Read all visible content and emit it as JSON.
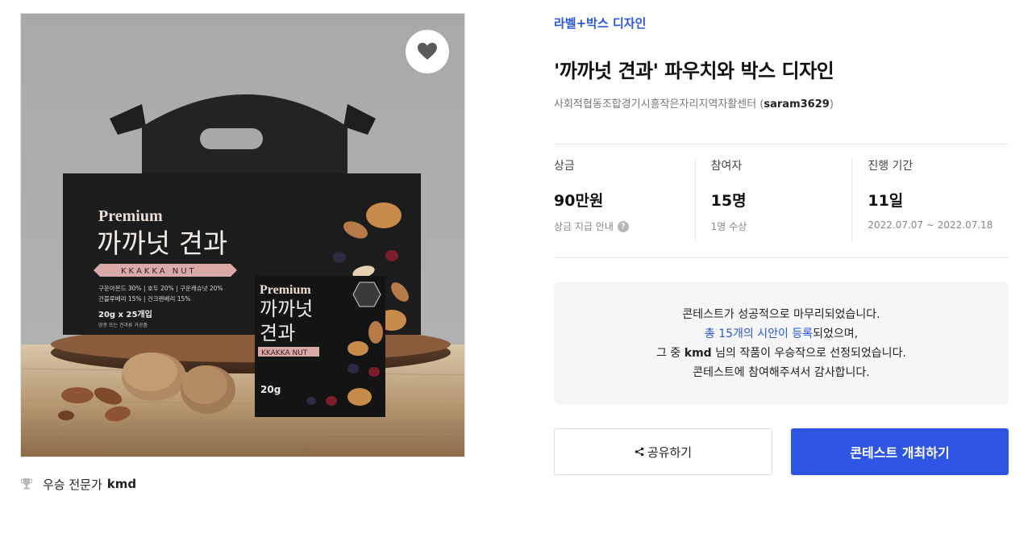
{
  "image": {
    "box_brand": "Premium",
    "box_name": "까까넛 견과",
    "box_subtitle": "KKAKKA NUT",
    "box_ingredients_1": "구운아몬드 30% | 호두 20% | 구운캐슈넛 20%",
    "box_ingredients_2": "건블루베리 15% | 건크랜베리 15%",
    "box_qty": "20g x 25개입",
    "box_note": "땅콩 또는 견과류 가공품",
    "pouch_brand": "Premium",
    "pouch_name_1": "까까넛",
    "pouch_name_2": "견과",
    "pouch_subtitle": "KKAKKA NUT",
    "pouch_weight": "20g"
  },
  "winner": {
    "label": "우승 전문가",
    "name": "kmd"
  },
  "contest": {
    "category": "라벨+박스 디자인",
    "title": "'까까넛 견과' 파우치와 박스 디자인",
    "organizer": "사회적협동조합경기시흥작은자리지역자활센터",
    "handle": "saram3629"
  },
  "stats": [
    {
      "label": "상금",
      "value": "90만원",
      "sub": "상금 지급 안내",
      "has_help": true
    },
    {
      "label": "참여자",
      "value": "15명",
      "sub": "1명 수상",
      "has_help": false
    },
    {
      "label": "진행 기간",
      "value": "11일",
      "sub": "2022.07.07 ~ 2022.07.18",
      "has_help": false
    }
  ],
  "notice": {
    "line1": "콘테스트가 성공적으로 마무리되었습니다.",
    "line2_link": "총 15개의 시안이 등록",
    "line2_rest": "되었으며,",
    "line3_pre": "그 중 ",
    "line3_name": "kmd",
    "line3_post": " 님의 작품이 우승작으로 선정되었습니다.",
    "line4": "콘테스트에 참여해주셔서 감사합니다."
  },
  "buttons": {
    "share": "공유하기",
    "host": "콘테스트 개최하기"
  },
  "colors": {
    "accent": "#2e55e4",
    "category": "#2c56d8",
    "notice_bg": "#f5f6f8"
  }
}
